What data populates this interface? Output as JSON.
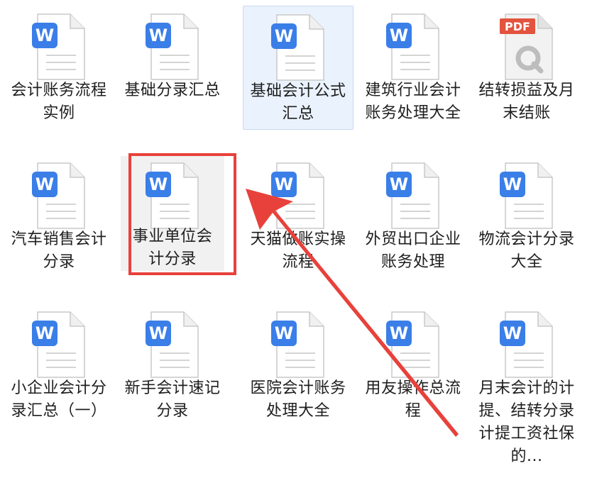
{
  "files": [
    {
      "name": "会计账务流程实例",
      "type": "doc"
    },
    {
      "name": "基础分录汇总",
      "type": "doc"
    },
    {
      "name": "基础会计公式汇总",
      "type": "doc",
      "state": "selected"
    },
    {
      "name": "建筑行业会计账务处理大全",
      "type": "doc"
    },
    {
      "name": "结转损益及月末结账",
      "type": "pdf"
    },
    {
      "name": "汽车销售会计分录",
      "type": "doc"
    },
    {
      "name": "事业单位会计分录",
      "type": "doc",
      "state": "highlighted"
    },
    {
      "name": "天猫做账实操流程",
      "type": "doc"
    },
    {
      "name": "外贸出口企业账务处理",
      "type": "doc"
    },
    {
      "name": "物流会计分录大全",
      "type": "doc"
    },
    {
      "name": "小企业会计分录汇总（一）",
      "type": "doc"
    },
    {
      "name": "新手会计速记分录",
      "type": "doc"
    },
    {
      "name": "医院会计账务处理大全",
      "type": "doc"
    },
    {
      "name": "用友操作总流程",
      "type": "doc"
    },
    {
      "name": "月末会计的计提、结转分录计提工资社保的...",
      "type": "doc"
    }
  ],
  "badges": {
    "pdf": "PDF",
    "word": "W"
  },
  "icons": {
    "doc": "word-document-icon",
    "pdf": "pdf-document-icon",
    "annotation": "red-arrow-icon"
  },
  "colors": {
    "word_blue": "#3a7ee8",
    "pdf_red": "#e3533f",
    "highlight_red": "#e8413b",
    "selection_bg": "#eaf2fd"
  }
}
